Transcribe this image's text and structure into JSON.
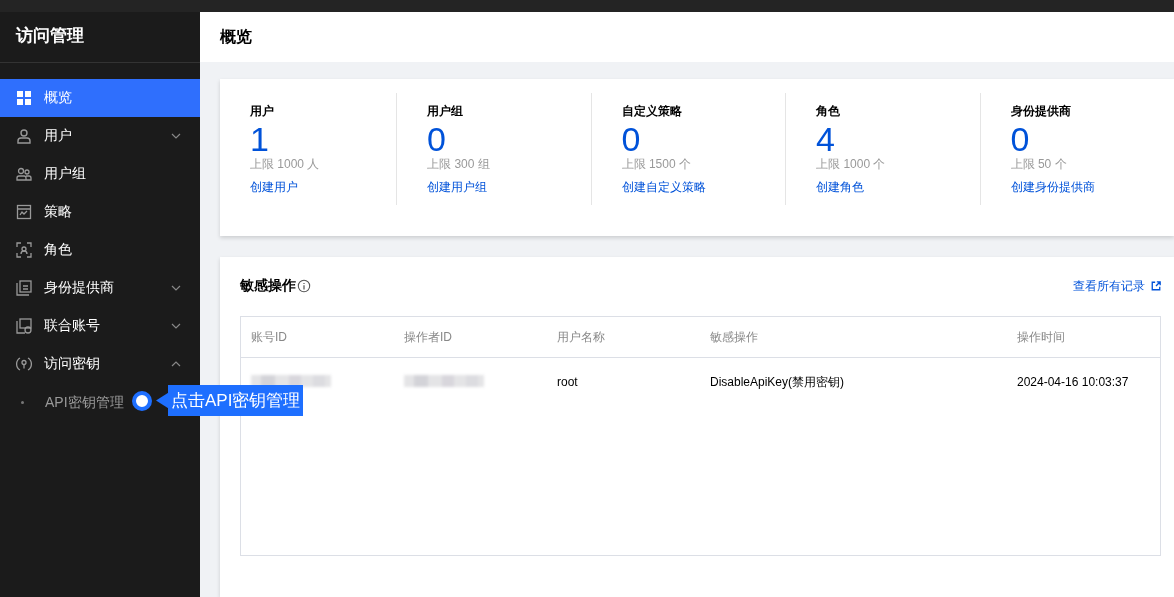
{
  "sidebar": {
    "title": "访问管理",
    "items": [
      {
        "label": "概览",
        "selected": true
      },
      {
        "label": "用户",
        "selected": false,
        "expanded": false
      },
      {
        "label": "用户组",
        "selected": false
      },
      {
        "label": "策略",
        "selected": false
      },
      {
        "label": "角色",
        "selected": false
      },
      {
        "label": "身份提供商",
        "selected": false,
        "expanded": false
      },
      {
        "label": "联合账号",
        "selected": false,
        "expanded": false
      },
      {
        "label": "访问密钥",
        "selected": false,
        "expanded": true,
        "children": [
          {
            "label": "API密钥管理",
            "selected": false
          }
        ]
      }
    ]
  },
  "callout": {
    "text": "点击API密钥管理"
  },
  "page": {
    "title": "概览"
  },
  "stats": [
    {
      "label": "用户",
      "value": "1",
      "limit": "上限 1000 人",
      "link": "创建用户"
    },
    {
      "label": "用户组",
      "value": "0",
      "limit": "上限 300 组",
      "link": "创建用户组"
    },
    {
      "label": "自定义策略",
      "value": "0",
      "limit": "上限 1500 个",
      "link": "创建自定义策略"
    },
    {
      "label": "角色",
      "value": "4",
      "limit": "上限 1000 个",
      "link": "创建角色"
    },
    {
      "label": "身份提供商",
      "value": "0",
      "limit": "上限 50 个",
      "link": "创建身份提供商"
    }
  ],
  "sensitive": {
    "title": "敏感操作",
    "link": "查看所有记录",
    "table": {
      "columns": [
        "账号ID",
        "操作者ID",
        "用户名称",
        "敏感操作",
        "操作时间"
      ],
      "rows": [
        {
          "cells": [
            {
              "kind": "blurred"
            },
            {
              "kind": "blurred"
            },
            {
              "kind": "text",
              "text": "root"
            },
            {
              "kind": "text",
              "text": "DisableApiKey(禁用密钥)"
            },
            {
              "kind": "text",
              "text": "2024-04-16 10:03:37"
            }
          ]
        }
      ]
    }
  }
}
